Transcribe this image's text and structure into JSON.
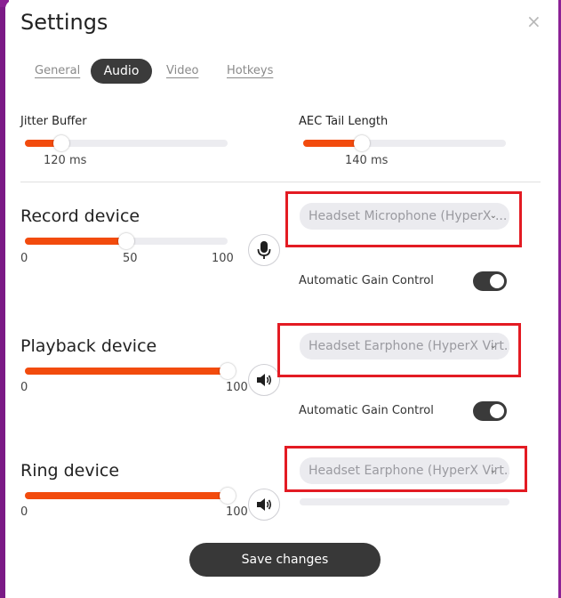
{
  "dialog": {
    "title": "Settings",
    "close_glyph": "×"
  },
  "tabs": [
    {
      "label": "General",
      "active": false
    },
    {
      "label": "Audio",
      "active": true
    },
    {
      "label": "Video",
      "active": false
    },
    {
      "label": "Hotkeys",
      "active": false
    }
  ],
  "jitter_buffer": {
    "label": "Jitter Buffer",
    "value_text": "120 ms",
    "fraction": 0.18
  },
  "aec_tail": {
    "label": "AEC Tail Length",
    "value_text": "140 ms",
    "fraction": 0.29
  },
  "record": {
    "label": "Record device",
    "level_fraction": 0.5,
    "ticks": [
      "0",
      "50",
      "100"
    ],
    "device": "Headset Microphone (HyperX ...",
    "icon": "microphone-icon",
    "agc_label": "Automatic Gain Control",
    "agc_on": true
  },
  "playback": {
    "label": "Playback device",
    "level_fraction": 1.0,
    "ticks": [
      "0",
      "100"
    ],
    "device": "Headset Earphone (HyperX Virt...",
    "icon": "speaker-icon",
    "agc_label": "Automatic Gain Control",
    "agc_on": true
  },
  "ring": {
    "label": "Ring device",
    "level_fraction": 1.0,
    "ticks": [
      "0",
      "100"
    ],
    "device": "Headset Earphone (HyperX Virt...",
    "icon": "speaker-icon"
  },
  "save_label": "Save changes",
  "colors": {
    "accent": "#f24b0d",
    "highlight": "#e31b23",
    "dark": "#383838"
  }
}
